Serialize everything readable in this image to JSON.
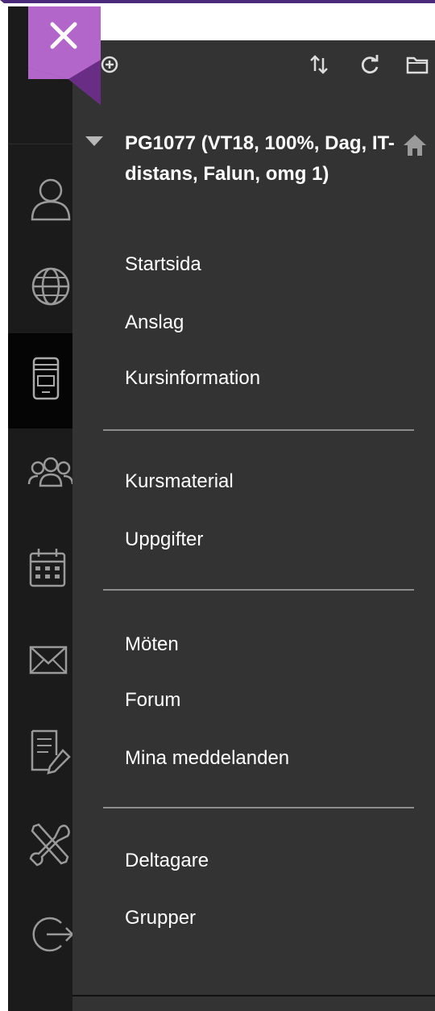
{
  "course": {
    "title": "PG1077 (VT18, 100%, Dag, IT-distans, Falun, omg 1)"
  },
  "menu": {
    "group1": [
      "Startsida",
      "Anslag",
      "Kursinformation"
    ],
    "group2": [
      "Kursmaterial",
      "Uppgifter"
    ],
    "group3": [
      "Möten",
      "Forum",
      "Mina meddelanden"
    ],
    "group4": [
      "Deltagare",
      "Grupper"
    ]
  },
  "rail_icons": [
    "user-icon",
    "globe-icon",
    "courses-icon",
    "groups-icon",
    "calendar-icon",
    "mail-icon",
    "grades-icon",
    "tools-icon",
    "logout-icon"
  ],
  "toolbar_icons": [
    "add-icon",
    "sort-icon",
    "refresh-icon",
    "folder-icon"
  ],
  "colors": {
    "accent": "#b366c9",
    "panel_bg": "#333333",
    "rail_bg": "#1b1b1b",
    "top_border": "#4b2a7a"
  }
}
